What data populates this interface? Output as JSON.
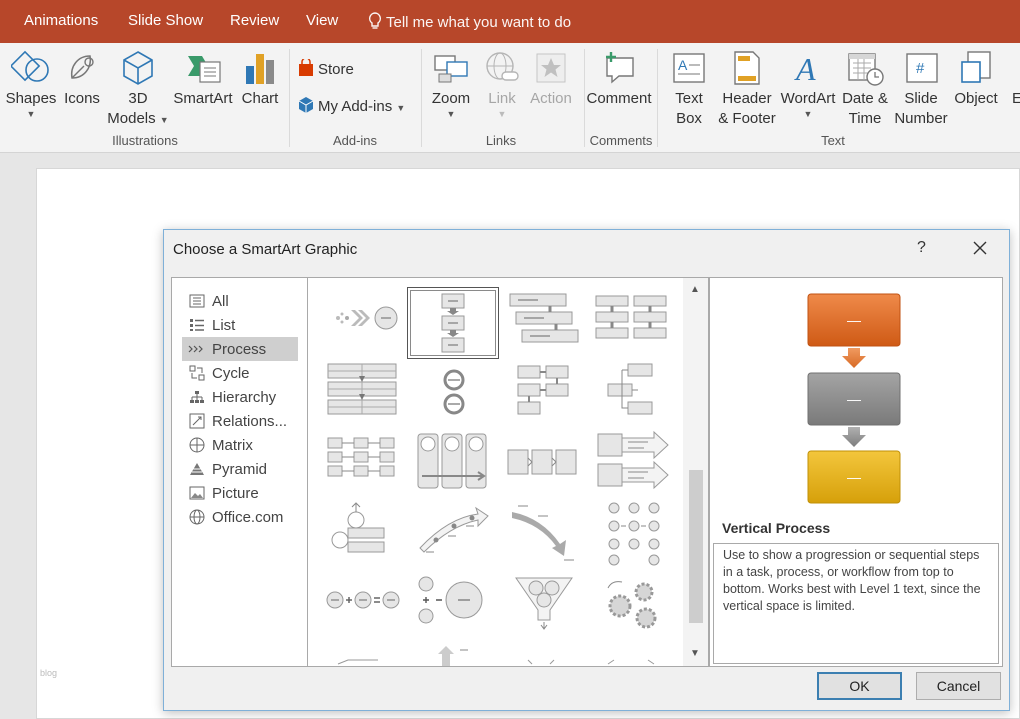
{
  "tabs": [
    "Animations",
    "Slide Show",
    "Review",
    "View"
  ],
  "tell_me": "Tell me what you want to do",
  "ribbon": {
    "illustrations": {
      "shapes": "Shapes",
      "icons": "Icons",
      "models_1": "3D",
      "models_2": "Models",
      "smartart": "SmartArt",
      "chart": "Chart",
      "group": "Illustrations"
    },
    "addins": {
      "store": "Store",
      "my_addins": "My Add-ins",
      "group": "Add-ins"
    },
    "links": {
      "zoom": "Zoom",
      "link": "Link",
      "action": "Action",
      "group": "Links"
    },
    "comments": {
      "comment": "Comment",
      "group": "Comments"
    },
    "text": {
      "textbox_1": "Text",
      "textbox_2": "Box",
      "header_1": "Header",
      "header_2": "& Footer",
      "wordart": "WordArt",
      "datetime_1": "Date &",
      "datetime_2": "Time",
      "slidenum_1": "Slide",
      "slidenum_2": "Number",
      "object": "Object",
      "more": "E",
      "group": "Text"
    }
  },
  "slide_watermark": "blog",
  "dialog": {
    "title": "Choose a SmartArt Graphic",
    "help": "?",
    "categories": [
      "All",
      "List",
      "Process",
      "Cycle",
      "Hierarchy",
      "Relations...",
      "Matrix",
      "Pyramid",
      "Picture",
      "Office.com"
    ],
    "selected_category": "Process",
    "preview": {
      "shape_text": "—",
      "colors": [
        "#e06a22",
        "#8a8a8a",
        "#e2ad0f"
      ],
      "name": "Vertical Process",
      "description": "Use to show a progression or sequential steps in a task, process, or workflow from top to bottom. Works best with Level 1 text, since the vertical space is limited."
    },
    "ok": "OK",
    "cancel": "Cancel"
  }
}
